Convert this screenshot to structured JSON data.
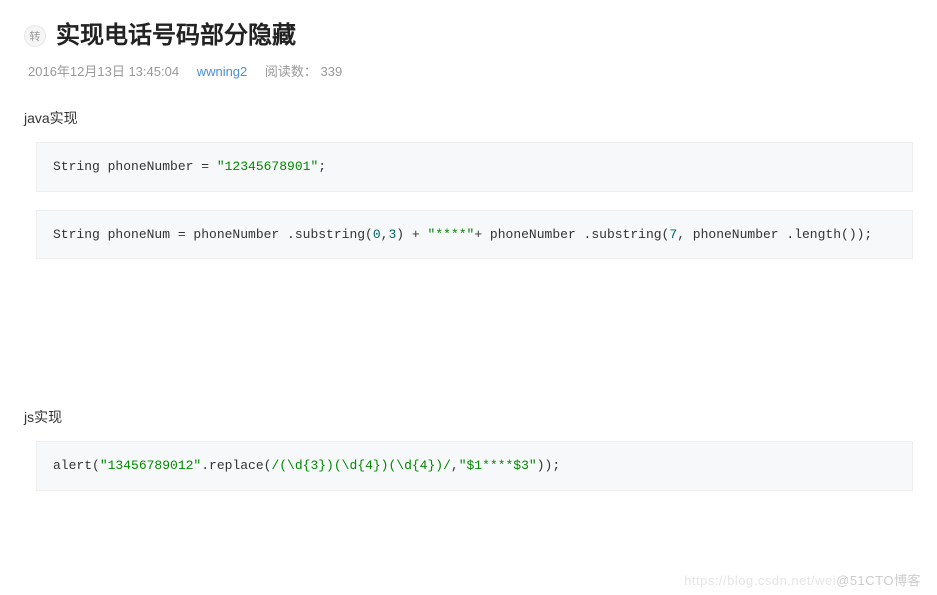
{
  "header": {
    "badge": "转",
    "title": "实现电话号码部分隐藏"
  },
  "meta": {
    "date": "2016年12月13日 13:45:04",
    "author": "wwning2",
    "views_label": "阅读数：",
    "views_count": "339"
  },
  "sections": {
    "java_label": "java实现",
    "java_code1_plain": "String phoneNumber = \"12345678901\";",
    "java_code2_plain": "String phoneNum = phoneNumber .substring(0,3) + \"****\"+ phoneNumber .substring(7, phoneNumber .length());",
    "js_label": "js实现",
    "js_code_plain": "alert(\"13456789012\".replace(/(\\d{3})(\\d{4})(\\d{4})/,\"$1****$3\"));"
  },
  "watermark": {
    "faint": "https://blog.csdn.net/wei",
    "main": "@51CTO博客"
  }
}
